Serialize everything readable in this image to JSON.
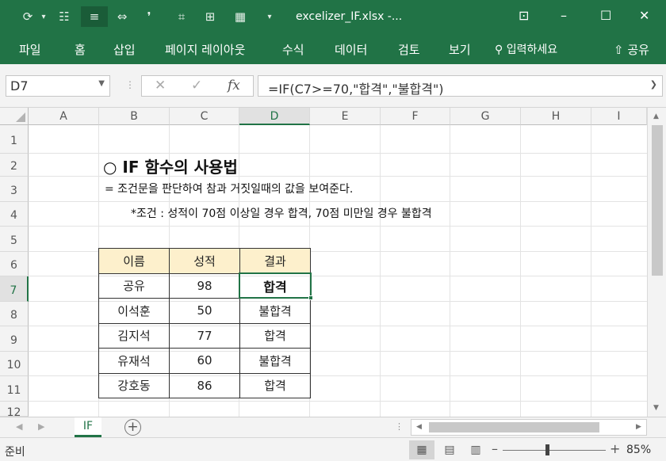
{
  "window": {
    "title": "excelizer_IF.xlsx  -...",
    "qat": [
      "⟳",
      "▾",
      "☷",
      "≡",
      "⇔",
      "❜",
      "⌗",
      "⊞",
      "▦",
      "▾"
    ],
    "controls": [
      "⊡",
      "–",
      "☐",
      "✕"
    ]
  },
  "ribbon": {
    "tabs": [
      "파일",
      "홈",
      "삽입",
      "페이지 레이아웃",
      "수식",
      "데이터",
      "검토",
      "보기"
    ],
    "tell_me": "입력하세요",
    "share": "공유"
  },
  "formula_bar": {
    "name_box": "D7",
    "cancel": "✕",
    "enter": "✓",
    "fx": "fx",
    "formula": "=IF(C7>=70,\"합격\",\"불합격\")"
  },
  "columns": [
    "A",
    "B",
    "C",
    "D",
    "E",
    "F",
    "G",
    "H",
    "I"
  ],
  "rows": [
    "1",
    "2",
    "3",
    "4",
    "5",
    "6",
    "7",
    "8",
    "9",
    "10",
    "11",
    "12"
  ],
  "sheet": {
    "heading": "○ IF 함수의 사용법",
    "description": "= 조건문을 판단하여 참과 거짓일때의 값을 보여준다.",
    "condition": "*조건 : 성적이 70점 이상일 경우 합격, 70점 미만일 경우 불합격",
    "table_headers": [
      "이름",
      "성적",
      "결과"
    ],
    "table_rows": [
      [
        "공유",
        "98",
        "합격"
      ],
      [
        "이석훈",
        "50",
        "불합격"
      ],
      [
        "김지석",
        "77",
        "합격"
      ],
      [
        "유재석",
        "60",
        "불합격"
      ],
      [
        "강호동",
        "86",
        "합격"
      ]
    ]
  },
  "sheet_tabs": [
    "IF"
  ],
  "status": {
    "ready": "준비",
    "zoom": "85%"
  },
  "colors": {
    "excel_green": "#217346",
    "header_fill": "#fdf0cc"
  }
}
